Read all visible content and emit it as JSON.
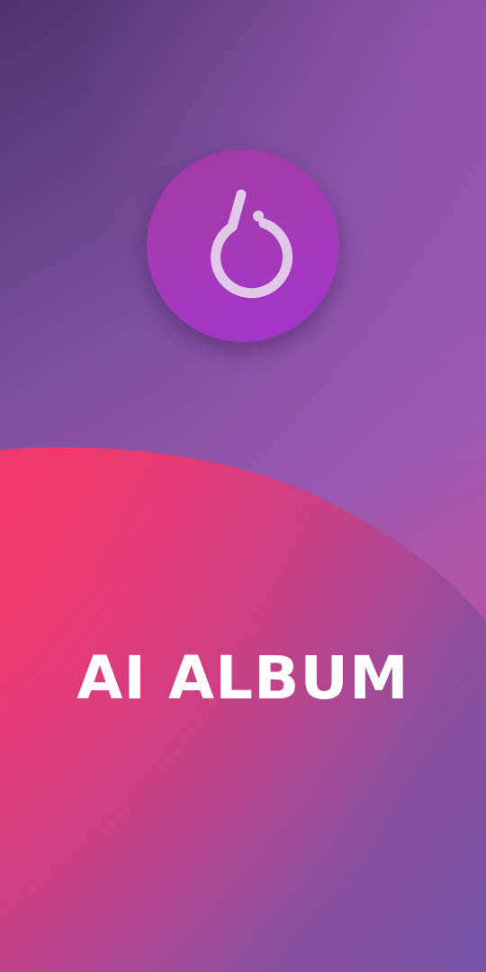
{
  "splash": {
    "title": "AI ALBUM",
    "logo_icon": "pytorch-flame-icon"
  },
  "colors": {
    "background_top": "#4f3270",
    "background_mid": "#9b58b0",
    "wave_pink": "#f0376e",
    "wave_purple": "#7a509e",
    "logo_circle": "#a53ab8",
    "logo_stroke": "#e2c8e8",
    "title_text": "#ffffff"
  }
}
